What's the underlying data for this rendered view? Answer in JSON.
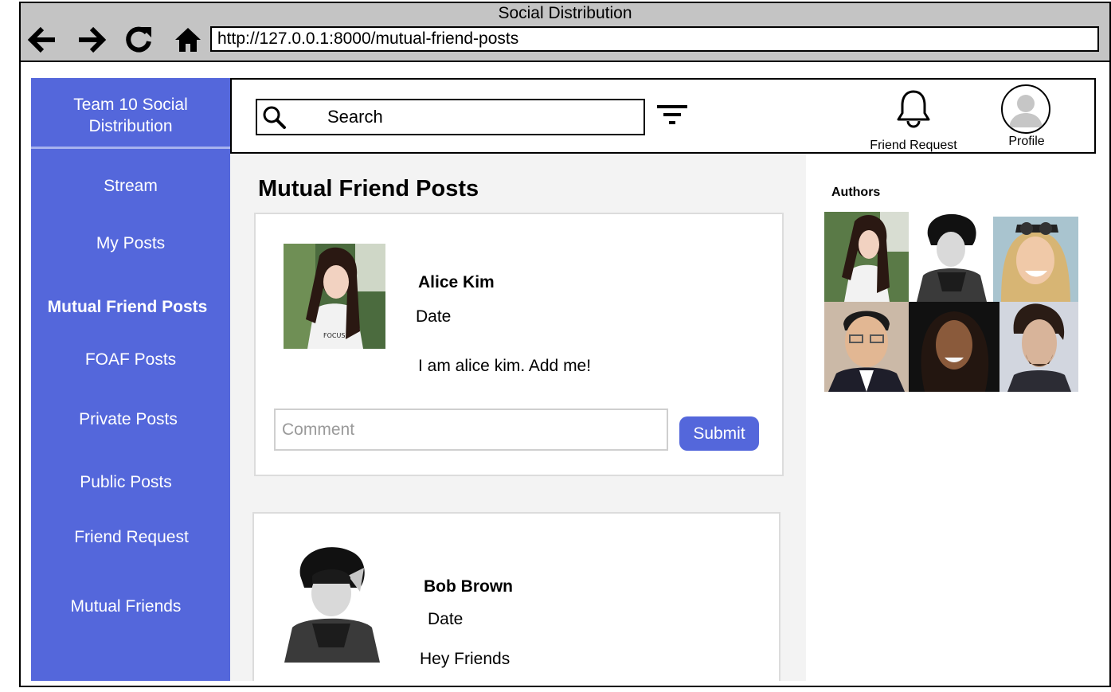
{
  "window": {
    "title": "Social Distribution"
  },
  "browser": {
    "url": "http://127.0.0.1:8000/mutual-friend-posts",
    "icons": [
      "back-arrow-icon",
      "forward-arrow-icon",
      "reload-icon",
      "home-icon"
    ]
  },
  "sidebar": {
    "brand": "Team 10 Social Distribution",
    "items": [
      {
        "label": "Stream",
        "active": false
      },
      {
        "label": "My Posts",
        "active": false
      },
      {
        "label": "Mutual Friend Posts",
        "active": true
      },
      {
        "label": "FOAF Posts",
        "active": false
      },
      {
        "label": "Private Posts",
        "active": false
      },
      {
        "label": "Public Posts",
        "active": false
      },
      {
        "label": "Friend Request",
        "active": false
      },
      {
        "label": "Mutual Friends",
        "active": false
      }
    ]
  },
  "topbar": {
    "search_label": "Search",
    "friend_request_label": "Friend Request",
    "profile_label": "Profile",
    "icons": [
      "search-icon",
      "filter-icon",
      "bell-icon",
      "profile-avatar-icon"
    ]
  },
  "main": {
    "title": "Mutual Friend Posts",
    "posts": [
      {
        "author": "Alice Kim",
        "date": "Date",
        "text": "I am alice kim. Add me!",
        "comment_placeholder": "Comment",
        "submit_label": "Submit"
      },
      {
        "author": "Bob Brown",
        "date": "Date",
        "text": "Hey Friends"
      }
    ]
  },
  "authors": {
    "title": "Authors",
    "count": 6
  },
  "colors": {
    "accent": "#5467db",
    "titlebar": "#c4c4c4",
    "content_bg": "#f3f3f3"
  }
}
